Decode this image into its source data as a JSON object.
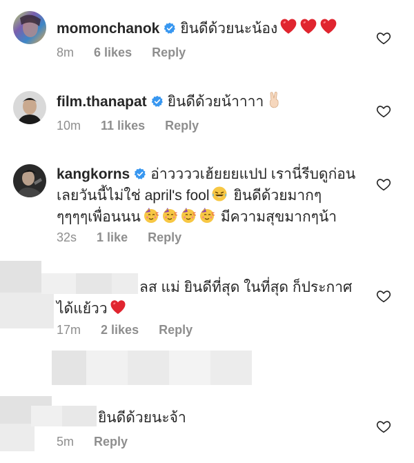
{
  "comments": [
    {
      "username": "momonchanok",
      "text": "ยินดีด้วยนะน้อง",
      "time": "8m",
      "likes": "6 likes",
      "reply": "Reply",
      "avatar_icon": "rainbow-portrait-avatar"
    },
    {
      "username": "film.thanapat",
      "text": "ยินดีด้วยน้าาาา",
      "time": "10m",
      "likes": "11 likes",
      "reply": "Reply",
      "avatar_icon": "dark-portrait-avatar"
    },
    {
      "username": "kangkorns",
      "text_1": "อ่าววววเฮ้ยยยแปป เรานี่รีบดูก่อน",
      "text_2": "เลยวันนี้ไม่ใช่ april's fool",
      "text_2b": "ยินดีด้วยมากๆ",
      "text_3": "ๆๆๆๆเพื่อนนน",
      "text_3b": "มีความสุขมากๆน้า",
      "time": "32s",
      "likes": "1 like",
      "reply": "Reply",
      "avatar_icon": "dark-portrait-avatar"
    },
    {
      "text_1": "ลส แม่ ยินดีที่สุด ในที่สุด ก็ประกาศ",
      "text_2": "ได้แย้วว",
      "time": "17m",
      "likes": "2 likes",
      "reply": "Reply",
      "avatar_icon": "blurred-avatar"
    },
    {
      "text": "ยินดีด้วยนะจ้า",
      "time": "5m",
      "reply": "Reply",
      "avatar_icon": "blurred-avatar"
    }
  ],
  "icons": {
    "heart": "heart-outline-icon",
    "verified": "verified-badge-icon",
    "red_heart": "red-heart-emoji",
    "victory_hand": "victory-hand-emoji",
    "laughing": "tears-of-joy-emoji",
    "party_face": "partying-face-emoji"
  },
  "colors": {
    "text": "#262626",
    "meta": "#8e8e8e",
    "verified": "#3897f0",
    "heart_emoji": "#e0252f",
    "blur": "#e6e6e6"
  }
}
